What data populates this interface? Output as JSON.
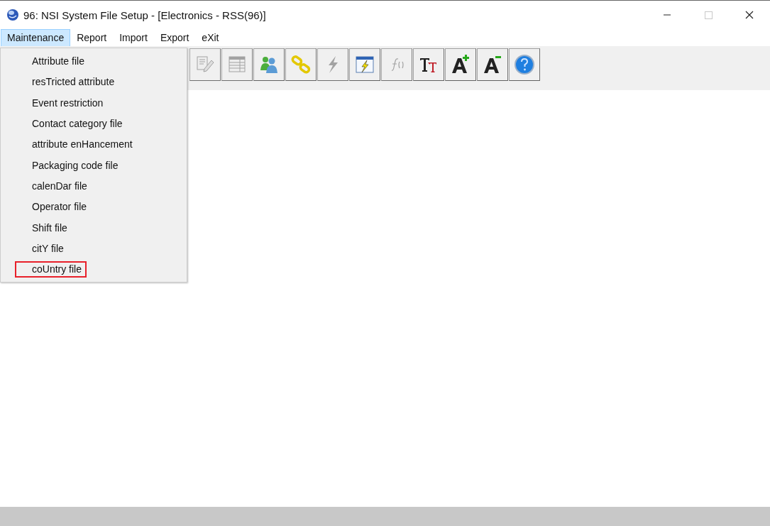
{
  "window": {
    "title": "96: NSI System File Setup - [Electronics - RSS(96)]",
    "controls": [
      {
        "kind": "minimize",
        "disabled": false
      },
      {
        "kind": "maximize",
        "disabled": true
      },
      {
        "kind": "close",
        "disabled": false
      }
    ]
  },
  "menu_bar": [
    {
      "label": "Maintenance",
      "selected": true
    },
    {
      "label": "Report",
      "selected": false
    },
    {
      "label": "Import",
      "selected": false
    },
    {
      "label": "Export",
      "selected": false
    },
    {
      "label": "eXit",
      "selected": false
    }
  ],
  "toolbar": [
    {
      "kind": "edit",
      "disabled": true
    },
    {
      "kind": "table",
      "disabled": true
    },
    {
      "kind": "users",
      "disabled": false
    },
    {
      "kind": "link",
      "disabled": false
    },
    {
      "kind": "bolt",
      "disabled": true
    },
    {
      "kind": "window-bolt",
      "disabled": false
    },
    {
      "kind": "function",
      "disabled": true
    },
    {
      "kind": "font",
      "disabled": false
    },
    {
      "kind": "font-up",
      "disabled": false
    },
    {
      "kind": "font-down",
      "disabled": false
    },
    {
      "kind": "help",
      "disabled": false
    }
  ],
  "dropdown": [
    {
      "label": "Attribute file",
      "highlighted": false
    },
    {
      "label": "resTricted attribute",
      "highlighted": false
    },
    {
      "label": "Event restriction",
      "highlighted": false
    },
    {
      "label": "Contact category file",
      "highlighted": false
    },
    {
      "label": "attribute enHancement",
      "highlighted": false
    },
    {
      "label": "Packaging code file",
      "highlighted": false
    },
    {
      "label": "calenDar file",
      "highlighted": false
    },
    {
      "label": "Operator file",
      "highlighted": false
    },
    {
      "label": "Shift file",
      "highlighted": false
    },
    {
      "label": "citY file",
      "highlighted": false
    },
    {
      "label": "coUntry file",
      "highlighted": true
    }
  ]
}
